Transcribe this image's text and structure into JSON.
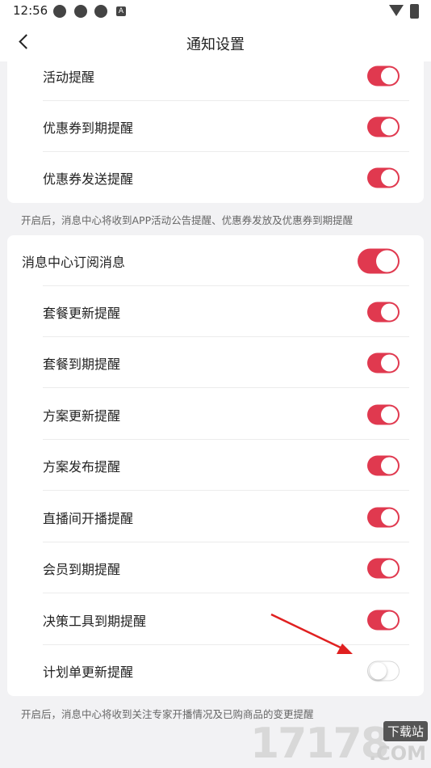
{
  "status_bar": {
    "time": "12:56",
    "icons": [
      "app-icon",
      "app-icon",
      "app-icon",
      "a-badge-icon",
      "wifi-icon",
      "battery-icon"
    ],
    "badge_letter": "A"
  },
  "nav": {
    "title": "通知设置",
    "back_icon": "chevron-left-icon"
  },
  "group1": {
    "items": [
      {
        "label": "活动提醒",
        "on": true
      },
      {
        "label": "优惠券到期提醒",
        "on": true
      },
      {
        "label": "优惠券发送提醒",
        "on": true
      }
    ],
    "hint": "开启后，消息中心将收到APP活动公告提醒、优惠券发放及优惠券到期提醒"
  },
  "group2": {
    "master": {
      "label": "消息中心订阅消息",
      "on": true
    },
    "items": [
      {
        "label": "套餐更新提醒",
        "on": true
      },
      {
        "label": "套餐到期提醒",
        "on": true
      },
      {
        "label": "方案更新提醒",
        "on": true
      },
      {
        "label": "方案发布提醒",
        "on": true
      },
      {
        "label": "直播间开播提醒",
        "on": true
      },
      {
        "label": "会员到期提醒",
        "on": true
      },
      {
        "label": "决策工具到期提醒",
        "on": true
      },
      {
        "label": "计划单更新提醒",
        "on": false
      }
    ],
    "hint": "开启后，消息中心将收到关注专家开播情况及已购商品的变更提醒"
  },
  "watermark": {
    "digits": "17178",
    "badge": "下载站",
    "domain": ".COM"
  },
  "colors": {
    "accent": "#e0394f",
    "annotation_arrow": "#e02020"
  }
}
